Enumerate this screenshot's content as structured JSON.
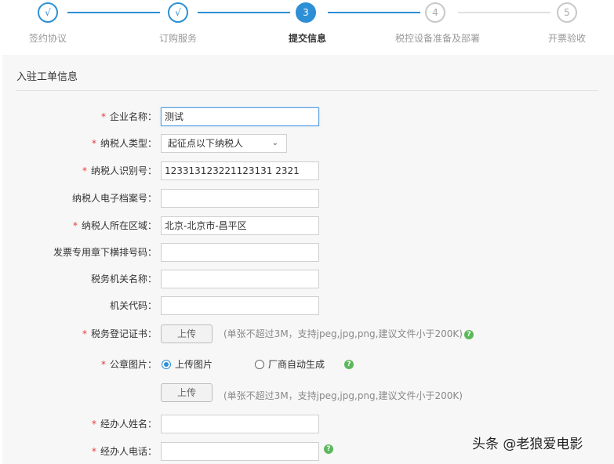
{
  "steps": [
    {
      "marker": "√",
      "label": "签约协议",
      "state": "done"
    },
    {
      "marker": "√",
      "label": "订购服务",
      "state": "done"
    },
    {
      "marker": "3",
      "label": "提交信息",
      "state": "active"
    },
    {
      "marker": "4",
      "label": "税控设备准备及部署",
      "state": "future"
    },
    {
      "marker": "5",
      "label": "开票验收",
      "state": "future"
    }
  ],
  "panel": {
    "title": "入驻工单信息"
  },
  "form": {
    "required_mark": "*",
    "company_name": {
      "label": "企业名称：",
      "value": "测试"
    },
    "taxpayer_type": {
      "label": "纳税人类型：",
      "value": "起征点以下纳税人"
    },
    "taxpayer_id": {
      "label": "纳税人识别号：",
      "value": "123313123221123131 2321"
    },
    "e_archive_no": {
      "label": "纳税人电子档案号：",
      "value": ""
    },
    "region": {
      "label": "纳税人所在区域：",
      "value": "北京-北京市-昌平区"
    },
    "invoice_seal_no": {
      "label": "发票专用章下横排号码：",
      "value": ""
    },
    "tax_office_name": {
      "label": "税务机关名称：",
      "value": ""
    },
    "office_code": {
      "label": "机关代码：",
      "value": ""
    },
    "tax_cert": {
      "label": "税务登记证书：",
      "button": "上传",
      "hint": "(单张不超过3M，支持jpeg,jpg,png,建议文件小于200K)"
    },
    "seal_image": {
      "label": "公章图片：",
      "option_upload": "上传图片",
      "option_auto": "厂商自动生成",
      "button": "上传",
      "hint": "(单张不超过3M，支持jpeg,jpg,png,建议文件小于200K)"
    },
    "operator_name": {
      "label": "经办人姓名：",
      "value": ""
    },
    "operator_phone": {
      "label": "经办人电话：",
      "value": ""
    }
  },
  "icons": {
    "help": "?",
    "chevron": "⌄"
  },
  "watermark": "头条 @老狼爱电影",
  "colors": {
    "accent": "#2d8fd5",
    "required": "#e4393c",
    "help": "#5cb85c"
  }
}
